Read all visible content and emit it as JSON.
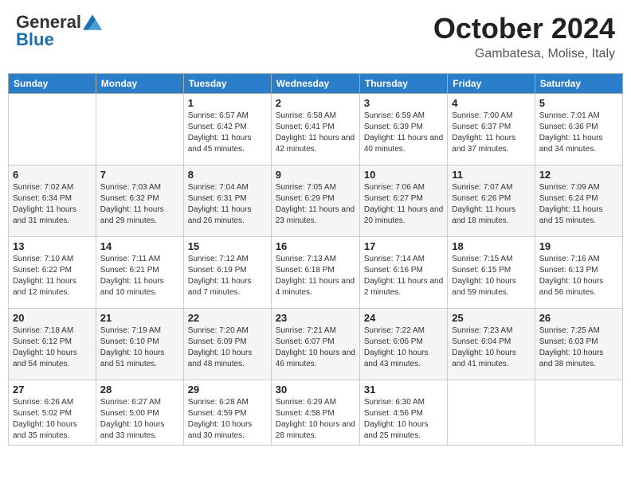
{
  "header": {
    "logo": {
      "general": "General",
      "blue": "Blue"
    },
    "title": "October 2024",
    "location": "Gambatesa, Molise, Italy"
  },
  "weekdays": [
    "Sunday",
    "Monday",
    "Tuesday",
    "Wednesday",
    "Thursday",
    "Friday",
    "Saturday"
  ],
  "weeks": [
    [
      {
        "day": "",
        "info": ""
      },
      {
        "day": "",
        "info": ""
      },
      {
        "day": "1",
        "sunrise": "Sunrise: 6:57 AM",
        "sunset": "Sunset: 6:42 PM",
        "daylight": "Daylight: 11 hours and 45 minutes."
      },
      {
        "day": "2",
        "sunrise": "Sunrise: 6:58 AM",
        "sunset": "Sunset: 6:41 PM",
        "daylight": "Daylight: 11 hours and 42 minutes."
      },
      {
        "day": "3",
        "sunrise": "Sunrise: 6:59 AM",
        "sunset": "Sunset: 6:39 PM",
        "daylight": "Daylight: 11 hours and 40 minutes."
      },
      {
        "day": "4",
        "sunrise": "Sunrise: 7:00 AM",
        "sunset": "Sunset: 6:37 PM",
        "daylight": "Daylight: 11 hours and 37 minutes."
      },
      {
        "day": "5",
        "sunrise": "Sunrise: 7:01 AM",
        "sunset": "Sunset: 6:36 PM",
        "daylight": "Daylight: 11 hours and 34 minutes."
      }
    ],
    [
      {
        "day": "6",
        "sunrise": "Sunrise: 7:02 AM",
        "sunset": "Sunset: 6:34 PM",
        "daylight": "Daylight: 11 hours and 31 minutes."
      },
      {
        "day": "7",
        "sunrise": "Sunrise: 7:03 AM",
        "sunset": "Sunset: 6:32 PM",
        "daylight": "Daylight: 11 hours and 29 minutes."
      },
      {
        "day": "8",
        "sunrise": "Sunrise: 7:04 AM",
        "sunset": "Sunset: 6:31 PM",
        "daylight": "Daylight: 11 hours and 26 minutes."
      },
      {
        "day": "9",
        "sunrise": "Sunrise: 7:05 AM",
        "sunset": "Sunset: 6:29 PM",
        "daylight": "Daylight: 11 hours and 23 minutes."
      },
      {
        "day": "10",
        "sunrise": "Sunrise: 7:06 AM",
        "sunset": "Sunset: 6:27 PM",
        "daylight": "Daylight: 11 hours and 20 minutes."
      },
      {
        "day": "11",
        "sunrise": "Sunrise: 7:07 AM",
        "sunset": "Sunset: 6:26 PM",
        "daylight": "Daylight: 11 hours and 18 minutes."
      },
      {
        "day": "12",
        "sunrise": "Sunrise: 7:09 AM",
        "sunset": "Sunset: 6:24 PM",
        "daylight": "Daylight: 11 hours and 15 minutes."
      }
    ],
    [
      {
        "day": "13",
        "sunrise": "Sunrise: 7:10 AM",
        "sunset": "Sunset: 6:22 PM",
        "daylight": "Daylight: 11 hours and 12 minutes."
      },
      {
        "day": "14",
        "sunrise": "Sunrise: 7:11 AM",
        "sunset": "Sunset: 6:21 PM",
        "daylight": "Daylight: 11 hours and 10 minutes."
      },
      {
        "day": "15",
        "sunrise": "Sunrise: 7:12 AM",
        "sunset": "Sunset: 6:19 PM",
        "daylight": "Daylight: 11 hours and 7 minutes."
      },
      {
        "day": "16",
        "sunrise": "Sunrise: 7:13 AM",
        "sunset": "Sunset: 6:18 PM",
        "daylight": "Daylight: 11 hours and 4 minutes."
      },
      {
        "day": "17",
        "sunrise": "Sunrise: 7:14 AM",
        "sunset": "Sunset: 6:16 PM",
        "daylight": "Daylight: 11 hours and 2 minutes."
      },
      {
        "day": "18",
        "sunrise": "Sunrise: 7:15 AM",
        "sunset": "Sunset: 6:15 PM",
        "daylight": "Daylight: 10 hours and 59 minutes."
      },
      {
        "day": "19",
        "sunrise": "Sunrise: 7:16 AM",
        "sunset": "Sunset: 6:13 PM",
        "daylight": "Daylight: 10 hours and 56 minutes."
      }
    ],
    [
      {
        "day": "20",
        "sunrise": "Sunrise: 7:18 AM",
        "sunset": "Sunset: 6:12 PM",
        "daylight": "Daylight: 10 hours and 54 minutes."
      },
      {
        "day": "21",
        "sunrise": "Sunrise: 7:19 AM",
        "sunset": "Sunset: 6:10 PM",
        "daylight": "Daylight: 10 hours and 51 minutes."
      },
      {
        "day": "22",
        "sunrise": "Sunrise: 7:20 AM",
        "sunset": "Sunset: 6:09 PM",
        "daylight": "Daylight: 10 hours and 48 minutes."
      },
      {
        "day": "23",
        "sunrise": "Sunrise: 7:21 AM",
        "sunset": "Sunset: 6:07 PM",
        "daylight": "Daylight: 10 hours and 46 minutes."
      },
      {
        "day": "24",
        "sunrise": "Sunrise: 7:22 AM",
        "sunset": "Sunset: 6:06 PM",
        "daylight": "Daylight: 10 hours and 43 minutes."
      },
      {
        "day": "25",
        "sunrise": "Sunrise: 7:23 AM",
        "sunset": "Sunset: 6:04 PM",
        "daylight": "Daylight: 10 hours and 41 minutes."
      },
      {
        "day": "26",
        "sunrise": "Sunrise: 7:25 AM",
        "sunset": "Sunset: 6:03 PM",
        "daylight": "Daylight: 10 hours and 38 minutes."
      }
    ],
    [
      {
        "day": "27",
        "sunrise": "Sunrise: 6:26 AM",
        "sunset": "Sunset: 5:02 PM",
        "daylight": "Daylight: 10 hours and 35 minutes."
      },
      {
        "day": "28",
        "sunrise": "Sunrise: 6:27 AM",
        "sunset": "Sunset: 5:00 PM",
        "daylight": "Daylight: 10 hours and 33 minutes."
      },
      {
        "day": "29",
        "sunrise": "Sunrise: 6:28 AM",
        "sunset": "Sunset: 4:59 PM",
        "daylight": "Daylight: 10 hours and 30 minutes."
      },
      {
        "day": "30",
        "sunrise": "Sunrise: 6:29 AM",
        "sunset": "Sunset: 4:58 PM",
        "daylight": "Daylight: 10 hours and 28 minutes."
      },
      {
        "day": "31",
        "sunrise": "Sunrise: 6:30 AM",
        "sunset": "Sunset: 4:56 PM",
        "daylight": "Daylight: 10 hours and 25 minutes."
      },
      {
        "day": "",
        "info": ""
      },
      {
        "day": "",
        "info": ""
      }
    ]
  ]
}
